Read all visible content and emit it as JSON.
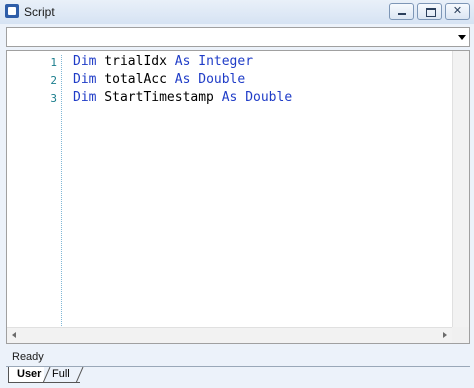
{
  "window": {
    "title": "Script"
  },
  "combo": {
    "value": ""
  },
  "editor": {
    "lines": [
      {
        "num": "1",
        "tokens": [
          "Dim",
          " trialIdx ",
          "As",
          " ",
          "Integer"
        ]
      },
      {
        "num": "2",
        "tokens": [
          "Dim",
          " totalAcc ",
          "As",
          " ",
          "Double"
        ]
      },
      {
        "num": "3",
        "tokens": [
          "Dim",
          " StartTimestamp ",
          "As",
          " ",
          "Double"
        ]
      }
    ]
  },
  "status": {
    "text": "Ready"
  },
  "tabs": [
    {
      "label": "User"
    },
    {
      "label": "Full"
    }
  ],
  "colors": {
    "keyword": "#1f3cc7",
    "line_number": "#1a7d8c",
    "titlebar": "#d6e3f3"
  }
}
